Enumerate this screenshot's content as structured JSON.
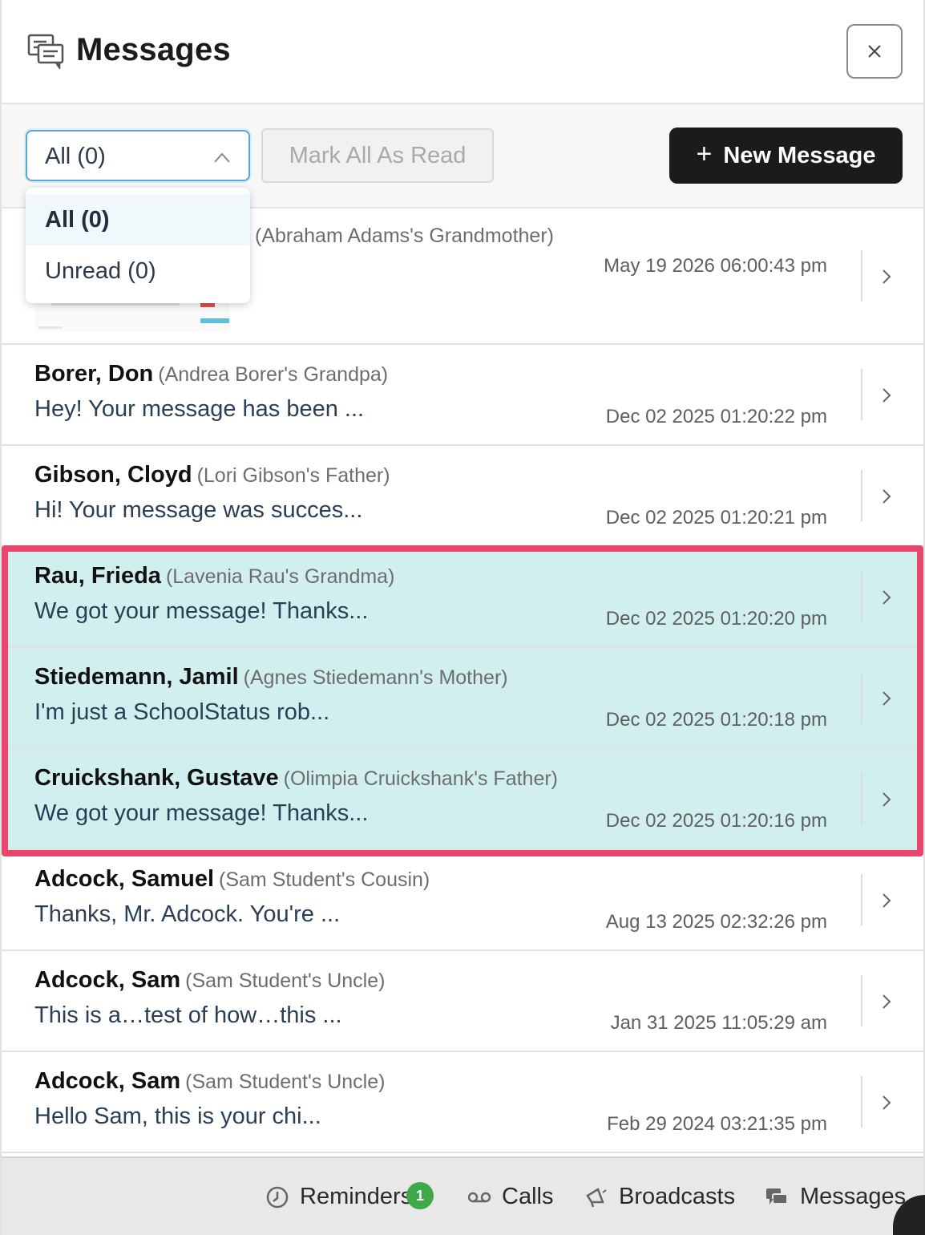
{
  "header": {
    "title": "Messages",
    "close_label": "×"
  },
  "toolbar": {
    "filter_value": "All (0)",
    "mark_all_read": "Mark All As Read",
    "new_message_plus": "+",
    "new_message": "New Message"
  },
  "dropdown": {
    "options": [
      "All (0)",
      "Unread (0)"
    ],
    "selected": "All (0)"
  },
  "first_row": {
    "relation": "(Abraham Adams's Grandmother)",
    "timestamp": "May 19 2026 06:00:43 pm"
  },
  "messages": [
    {
      "name": "Borer, Don",
      "relation": "(Andrea Borer's Grandpa)",
      "preview": "Hey! Your message has been ...",
      "timestamp": "Dec 02 2025 01:20:22 pm",
      "highlighted": false
    },
    {
      "name": "Gibson, Cloyd",
      "relation": "(Lori Gibson's Father)",
      "preview": "Hi! Your message was succes...",
      "timestamp": "Dec 02 2025 01:20:21 pm",
      "highlighted": false
    },
    {
      "name": "Rau, Frieda",
      "relation": "(Lavenia Rau's Grandma)",
      "preview": "We got your message! Thanks...",
      "timestamp": "Dec 02 2025 01:20:20 pm",
      "highlighted": true
    },
    {
      "name": "Stiedemann, Jamil",
      "relation": "(Agnes Stiedemann's Mother)",
      "preview": "I'm just a SchoolStatus rob...",
      "timestamp": "Dec 02 2025 01:20:18 pm",
      "highlighted": true
    },
    {
      "name": "Cruickshank, Gustave",
      "relation": "(Olimpia Cruickshank's Father)",
      "preview": "We got your message! Thanks...",
      "timestamp": "Dec 02 2025 01:20:16 pm",
      "highlighted": true
    },
    {
      "name": "Adcock, Samuel",
      "relation": "(Sam Student's Cousin)",
      "preview": "Thanks, Mr. Adcock. You're ...",
      "timestamp": "Aug 13 2025 02:32:26 pm",
      "highlighted": false
    },
    {
      "name": "Adcock, Sam",
      "relation": "(Sam Student's Uncle)",
      "preview": "This is a…test of how…this ...",
      "timestamp": "Jan 31 2025 11:05:29 am",
      "highlighted": false
    },
    {
      "name": "Adcock, Sam",
      "relation": "(Sam Student's Uncle)",
      "preview": "Hello Sam, this is your chi...",
      "timestamp": "Feb 29 2024 03:21:35 pm",
      "highlighted": false
    }
  ],
  "bottom_nav": {
    "reminders": "Reminders",
    "reminders_badge": "1",
    "calls": "Calls",
    "broadcasts": "Broadcasts",
    "messages": "Messages"
  },
  "colors": {
    "highlight_row": "#d0efee",
    "highlight_frame": "#e8466c",
    "primary_button": "#1b1b1b",
    "badge": "#3fa84a"
  }
}
